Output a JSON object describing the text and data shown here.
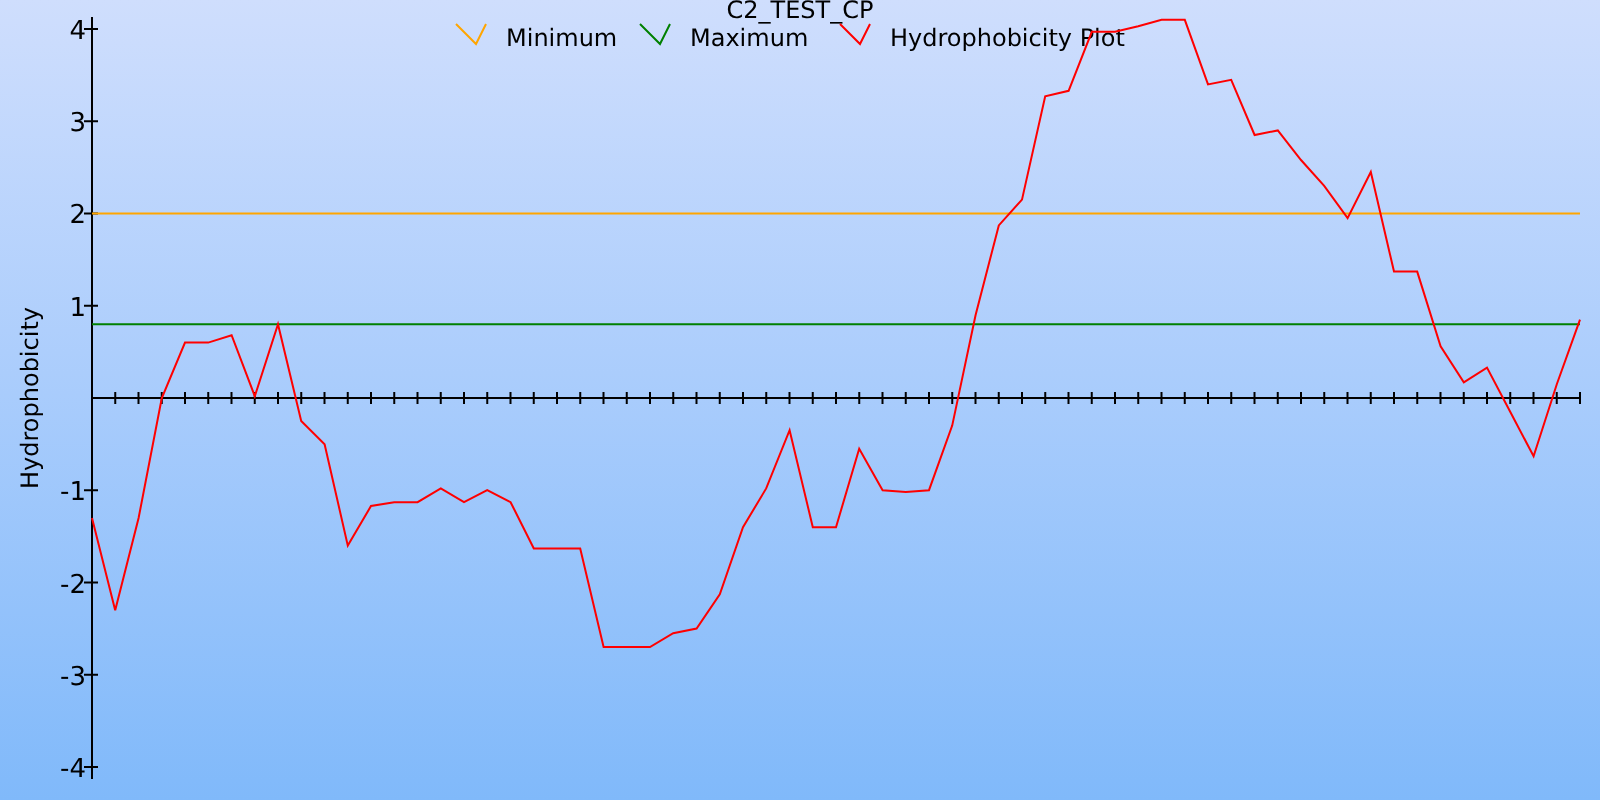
{
  "chart_data": {
    "type": "line",
    "title": "C2_TEST_CP",
    "ylabel": "Hydrophobicity",
    "ylim": [
      -4.13,
      4.13
    ],
    "yticks": [
      -4,
      -3,
      -2,
      -1,
      1,
      2,
      3,
      4
    ],
    "legend": true,
    "series": [
      {
        "name": "Minimum",
        "color": "#ffa500",
        "values": [
          2,
          2,
          2,
          2,
          2,
          2,
          2,
          2,
          2,
          2,
          2,
          2,
          2,
          2,
          2,
          2,
          2,
          2,
          2,
          2,
          2,
          2,
          2,
          2,
          2,
          2,
          2,
          2,
          2,
          2,
          2,
          2,
          2,
          2,
          2,
          2,
          2,
          2,
          2,
          2,
          2,
          2,
          2,
          2,
          2,
          2,
          2,
          2,
          2,
          2,
          2,
          2,
          2,
          2,
          2,
          2,
          2,
          2,
          2,
          2,
          2,
          2,
          2,
          2,
          2
        ]
      },
      {
        "name": "Maximum",
        "color": "#008000",
        "values": [
          0.8,
          0.8,
          0.8,
          0.8,
          0.8,
          0.8,
          0.8,
          0.8,
          0.8,
          0.8,
          0.8,
          0.8,
          0.8,
          0.8,
          0.8,
          0.8,
          0.8,
          0.8,
          0.8,
          0.8,
          0.8,
          0.8,
          0.8,
          0.8,
          0.8,
          0.8,
          0.8,
          0.8,
          0.8,
          0.8,
          0.8,
          0.8,
          0.8,
          0.8,
          0.8,
          0.8,
          0.8,
          0.8,
          0.8,
          0.8,
          0.8,
          0.8,
          0.8,
          0.8,
          0.8,
          0.8,
          0.8,
          0.8,
          0.8,
          0.8,
          0.8,
          0.8,
          0.8,
          0.8,
          0.8,
          0.8,
          0.8,
          0.8,
          0.8,
          0.8,
          0.8,
          0.8,
          0.8,
          0.8,
          0.8
        ]
      },
      {
        "name": "Hydrophobicity Plot",
        "color": "#ff0000",
        "values": [
          -1.3,
          -2.3,
          -1.3,
          0,
          0.6,
          0.6,
          0.68,
          0.02,
          0.8,
          -0.25,
          -0.5,
          -1.6,
          -1.17,
          -1.13,
          -1.13,
          -0.98,
          -1.13,
          -1,
          -1.13,
          -1.63,
          -1.63,
          -1.63,
          -2.7,
          -2.7,
          -2.7,
          -2.55,
          -2.5,
          -2.13,
          -1.4,
          -0.98,
          -0.35,
          -1.4,
          -1.4,
          -0.55,
          -1,
          -1.02,
          -1,
          -0.3,
          0.9,
          1.87,
          2.15,
          3.27,
          3.33,
          3.97,
          3.97,
          4.03,
          4.1,
          4.1,
          3.4,
          3.45,
          2.85,
          2.9,
          2.58,
          2.3,
          1.95,
          2.45,
          1.37,
          1.37,
          0.56,
          0.17,
          0.33,
          -0.15,
          -0.63,
          0.15,
          0.85
        ]
      }
    ]
  }
}
